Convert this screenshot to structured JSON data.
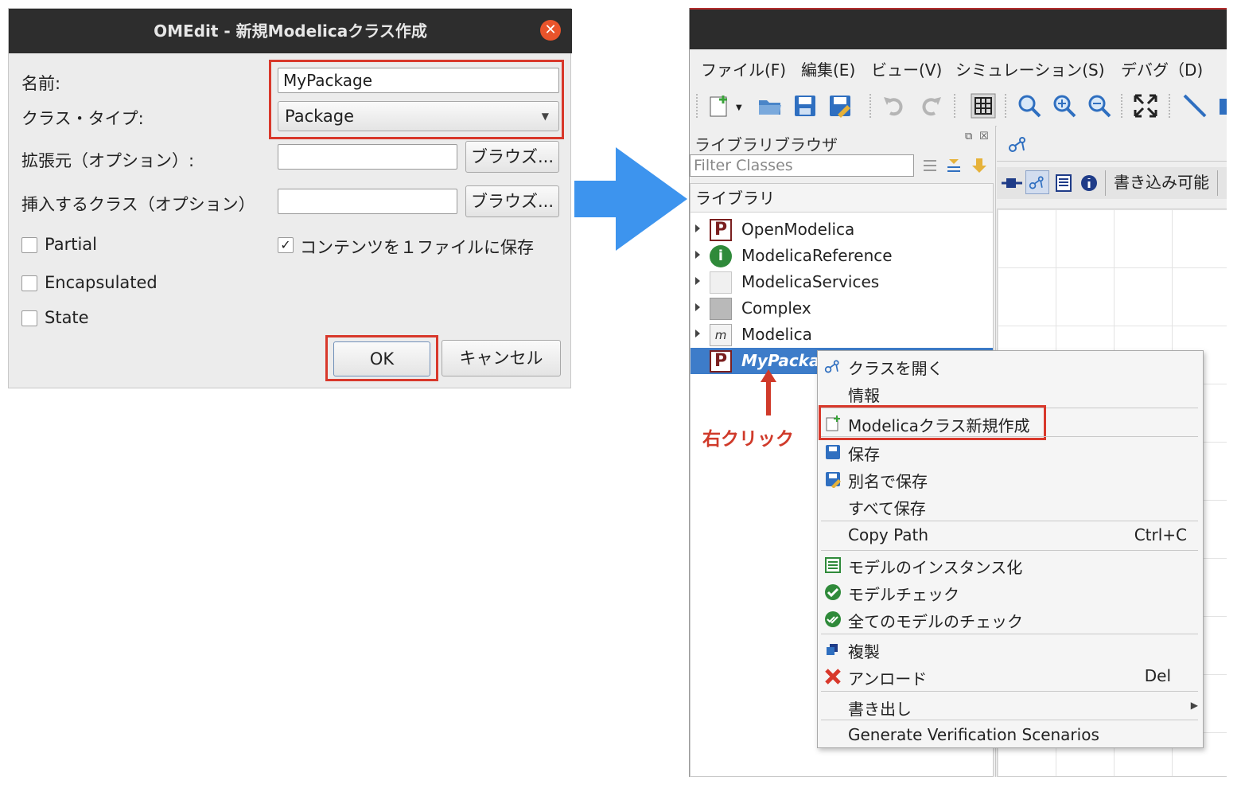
{
  "dialog": {
    "title": "OMEdit - 新規Modelicaクラス作成",
    "name_label": "名前:",
    "name_value": "MyPackage",
    "class_type_label": "クラス・タイプ:",
    "class_type_value": "Package",
    "extends_label": "拡張元（オプション）:",
    "insert_label": "挿入するクラス（オプション）",
    "browse_label": "ブラウズ...",
    "partial_label": "Partial",
    "save_one_file_label": "コンテンツを１ファイルに保存",
    "encapsulated_label": "Encapsulated",
    "state_label": "State",
    "ok_label": "OK",
    "cancel_label": "キャンセル",
    "save_one_file_checked": true
  },
  "omedit": {
    "menu": [
      "ファイル(F)",
      "編集(E)",
      "ビュー(V)",
      "シミュレーション(S)",
      "デバグ（D)"
    ],
    "library_browser_title": "ライブラリブラウザ",
    "filter_placeholder": "Filter Classes",
    "tree_header": "ライブラリ",
    "tree_items": [
      "OpenModelica",
      "ModelicaReference",
      "ModelicaServices",
      "Complex",
      "Modelica",
      "MyPackage"
    ],
    "writable_label": "書き込み可能"
  },
  "context_menu": {
    "open_class": "クラスを開く",
    "info": "情報",
    "new_class": "Modelicaクラス新規作成",
    "save": "保存",
    "save_as": "別名で保存",
    "save_all": "すべて保存",
    "copy_path": "Copy Path",
    "copy_path_shortcut": "Ctrl+C",
    "instantiate": "モデルのインスタンス化",
    "check_model": "モデルチェック",
    "check_all": "全てのモデルのチェック",
    "duplicate": "複製",
    "unload": "アンロード",
    "unload_shortcut": "Del",
    "export": "書き出し",
    "generate_verification": "Generate Verification Scenarios"
  },
  "annotation": {
    "right_click": "右クリック"
  },
  "colors": {
    "highlight_red": "#d8382b",
    "arrow_blue": "#3d94ee",
    "selection_blue": "#3d7cc9"
  }
}
